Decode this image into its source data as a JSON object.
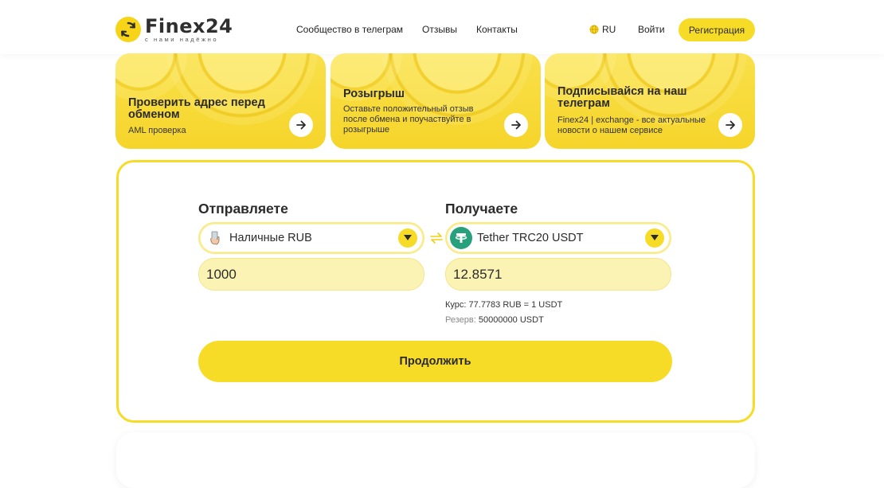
{
  "brand": {
    "name": "Finex24",
    "tagline": "с нами надёжно",
    "accent": "#f7dc27",
    "logo_icon": "refresh-circle-icon"
  },
  "header": {
    "nav": [
      "Сообщество в телеграм",
      "Отзывы",
      "Контакты"
    ],
    "lang_label": "RU",
    "lang_icon": "globe-icon",
    "login_label": "Войти",
    "register_label": "Регистрация"
  },
  "promos": [
    {
      "title": "Проверить адрес перед обменом",
      "desc": "AML проверка",
      "icon": "arrow-right-icon"
    },
    {
      "title": "Розыгрыш",
      "desc": "Оставьте положительный отзыв после обмена и поучаствуйте в розыгрыше",
      "icon": "arrow-right-icon"
    },
    {
      "title": "Подписывайся на наш телеграм",
      "desc": "Finex24 | exchange - все актуальные новости о нашем сервисе",
      "icon": "arrow-right-icon"
    }
  ],
  "exchange": {
    "send_label": "Отправляете",
    "receive_label": "Получаете",
    "send_currency": "Наличные RUB",
    "send_icon": "cash-hand-icon",
    "receive_currency": "Tether TRC20 USDT",
    "receive_icon": "tether-icon",
    "send_amount": "1000",
    "receive_amount": "12.8571",
    "rate_label": "Курс:",
    "rate_value": "77.7783 RUB = 1 USDT",
    "reserve_label": "Резерв:",
    "reserve_value": "50000000 USDT",
    "continue_label": "Продолжить",
    "swap_icon": "swap-arrows-icon"
  }
}
